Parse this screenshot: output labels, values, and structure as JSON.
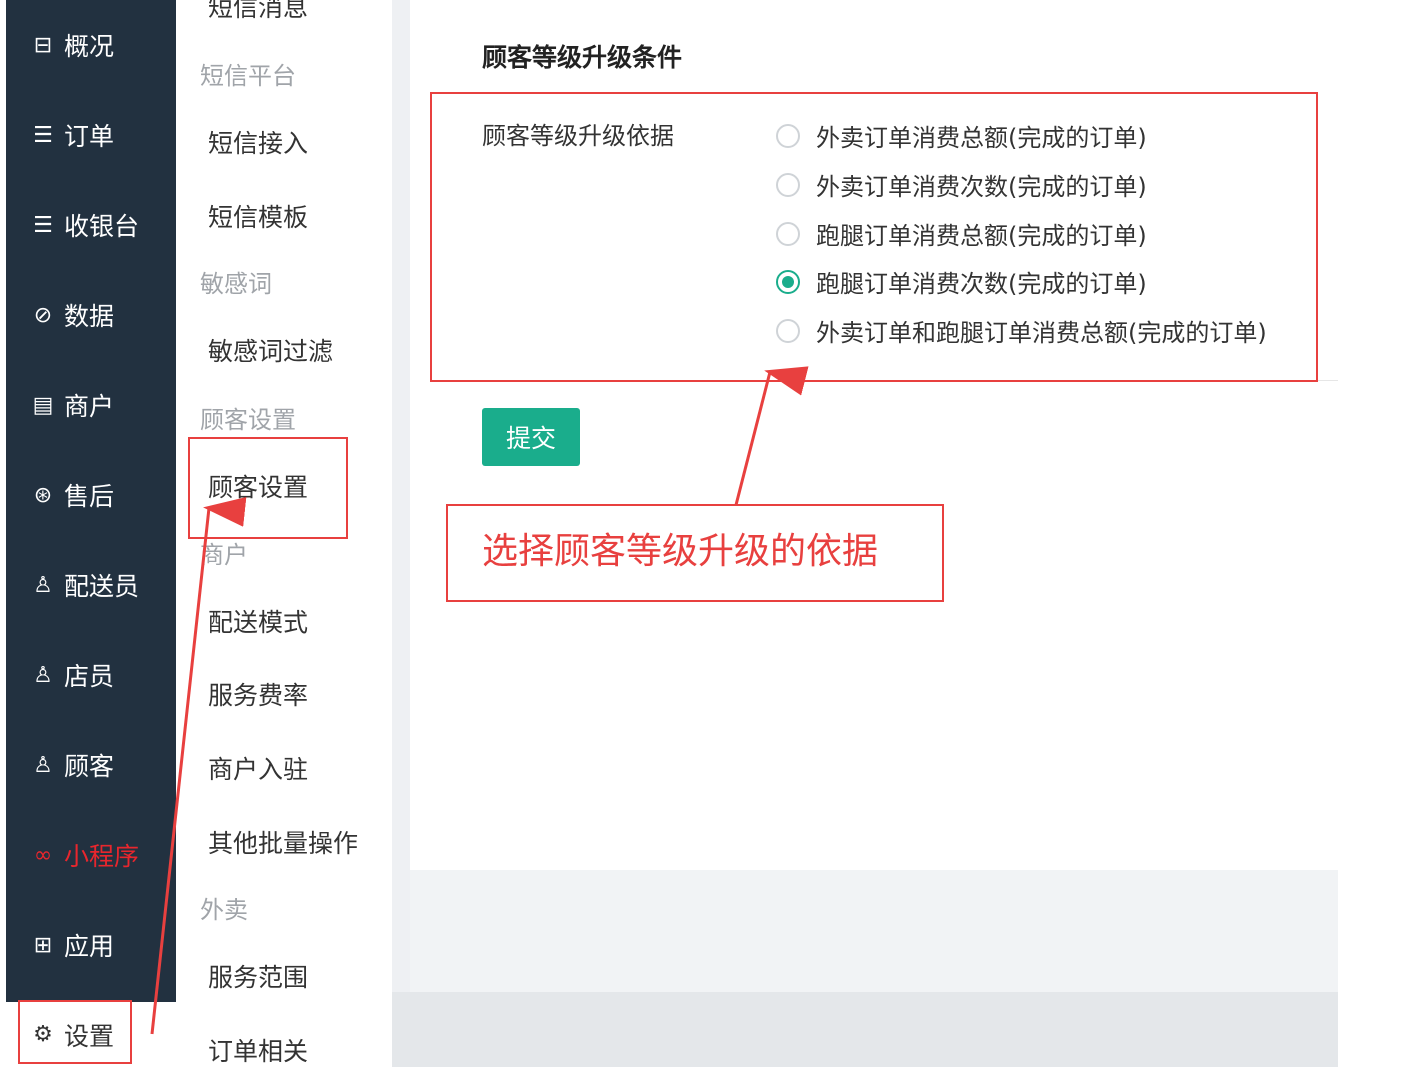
{
  "nav": {
    "items": [
      {
        "label": "概况",
        "icon": "dashboard-icon",
        "glyph": "⊟"
      },
      {
        "label": "订单",
        "icon": "order-icon",
        "glyph": "☰"
      },
      {
        "label": "收银台",
        "icon": "cashier-icon",
        "glyph": "☰"
      },
      {
        "label": "数据",
        "icon": "data-chart-icon",
        "glyph": "⊘"
      },
      {
        "label": "商户",
        "icon": "store-icon",
        "glyph": "▤"
      },
      {
        "label": "售后",
        "icon": "after-sales-icon",
        "glyph": "⊛"
      },
      {
        "label": "配送员",
        "icon": "courier-icon",
        "glyph": "♙"
      },
      {
        "label": "店员",
        "icon": "staff-icon",
        "glyph": "♙"
      },
      {
        "label": "顾客",
        "icon": "customer-icon",
        "glyph": "♙"
      },
      {
        "label": "小程序",
        "icon": "mini-program-icon",
        "glyph": "∞"
      },
      {
        "label": "应用",
        "icon": "apps-icon",
        "glyph": "⊞"
      }
    ],
    "settings": {
      "label": "设置",
      "icon": "gear-icon",
      "glyph": "⚙"
    }
  },
  "submenu": {
    "top_partial": "短信消息",
    "entries": [
      {
        "type": "group",
        "label": "短信平台"
      },
      {
        "type": "item",
        "label": "短信接入"
      },
      {
        "type": "item",
        "label": "短信模板"
      },
      {
        "type": "group",
        "label": "敏感词"
      },
      {
        "type": "item",
        "label": "敏感词过滤"
      },
      {
        "type": "group",
        "label": "顾客设置"
      },
      {
        "type": "item",
        "label": "顾客设置"
      },
      {
        "type": "group",
        "label": "商户"
      },
      {
        "type": "item",
        "label": "配送模式"
      },
      {
        "type": "item",
        "label": "服务费率"
      },
      {
        "type": "item",
        "label": "商户入驻"
      },
      {
        "type": "item",
        "label": "其他批量操作"
      },
      {
        "type": "group",
        "label": "外卖"
      },
      {
        "type": "item",
        "label": "服务范围"
      },
      {
        "type": "item",
        "label": "订单相关"
      }
    ]
  },
  "main": {
    "section_title": "顾客等级升级条件",
    "field_label": "顾客等级升级依据",
    "options": [
      {
        "label": "外卖订单消费总额(完成的订单)",
        "checked": false
      },
      {
        "label": "外卖订单消费次数(完成的订单)",
        "checked": false
      },
      {
        "label": "跑腿订单消费总额(完成的订单)",
        "checked": false
      },
      {
        "label": "跑腿订单消费次数(完成的订单)",
        "checked": true
      },
      {
        "label": "外卖订单和跑腿订单消费总额(完成的订单)",
        "checked": false
      }
    ],
    "submit_label": "提交"
  },
  "annotation": {
    "text": "选择顾客等级升级的依据",
    "color": "#e8403f"
  },
  "colors": {
    "accent": "#1aad8c",
    "nav_bg": "#223140",
    "active_nav": "#e8262d"
  }
}
